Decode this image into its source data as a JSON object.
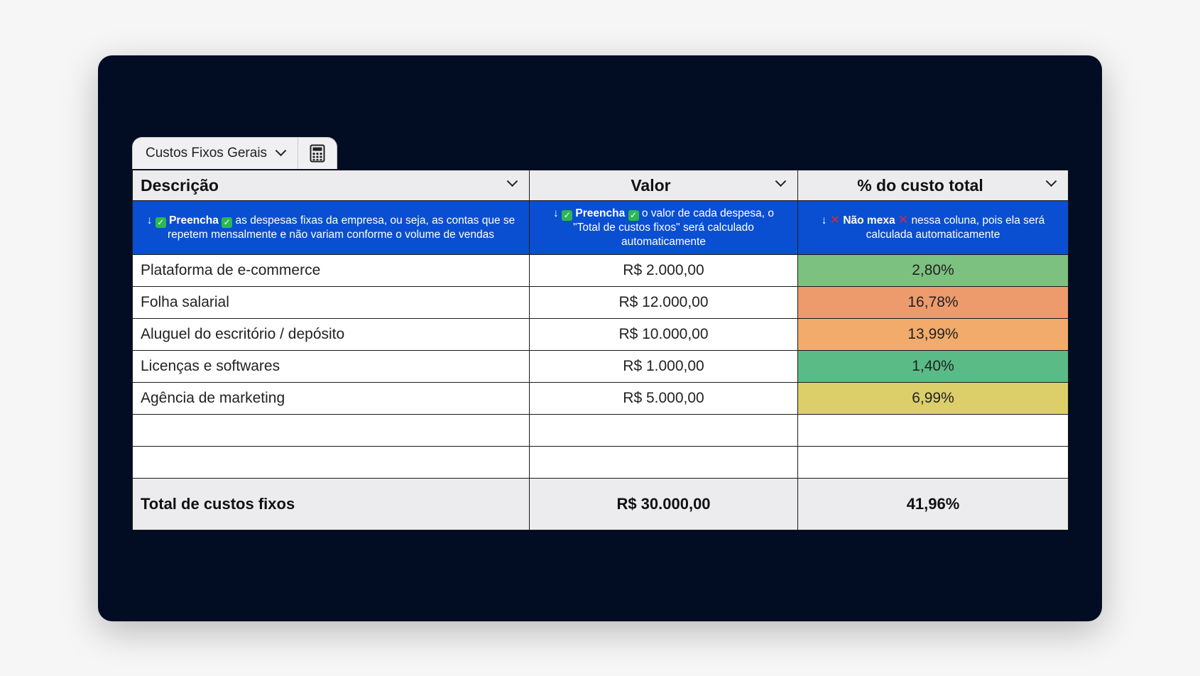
{
  "sheet_tab": {
    "label": "Custos Fixos Gerais",
    "calc_icon": "calculator-icon"
  },
  "headers": {
    "descricao": "Descrição",
    "valor": "Valor",
    "percent": "% do custo total"
  },
  "instructions": {
    "descricao": {
      "arrow": "↓",
      "bold": "Preencha",
      "text": "as despesas fixas da empresa, ou seja, as contas que se repetem mensalmente e não variam conforme o volume de vendas"
    },
    "valor": {
      "arrow": "↓",
      "bold": "Preencha",
      "text": "o valor de cada despesa, o \"Total de custos fixos\" será calculado automaticamente"
    },
    "percent": {
      "arrow": "↓",
      "bold": "Não mexa",
      "text": "nessa coluna, pois ela será calculada automaticamente"
    }
  },
  "rows": [
    {
      "desc": "Plataforma de e-commerce",
      "valor": "R$ 2.000,00",
      "pct": "2,80%",
      "color": "#7cc180"
    },
    {
      "desc": "Folha salarial",
      "valor": "R$ 12.000,00",
      "pct": "16,78%",
      "color": "#ed9b6d"
    },
    {
      "desc": "Aluguel do escritório / depósito",
      "valor": "R$ 10.000,00",
      "pct": "13,99%",
      "color": "#f2ab6b"
    },
    {
      "desc": "Licenças e softwares",
      "valor": "R$ 1.000,00",
      "pct": "1,40%",
      "color": "#5bbb86"
    },
    {
      "desc": "Agência de marketing",
      "valor": "R$ 5.000,00",
      "pct": "6,99%",
      "color": "#dccf6a"
    },
    {
      "desc": "",
      "valor": "",
      "pct": "",
      "color": "#ffffff"
    },
    {
      "desc": "",
      "valor": "",
      "pct": "",
      "color": "#ffffff"
    }
  ],
  "total": {
    "label": "Total de custos fixos",
    "valor": "R$ 30.000,00",
    "pct": "41,96%"
  }
}
